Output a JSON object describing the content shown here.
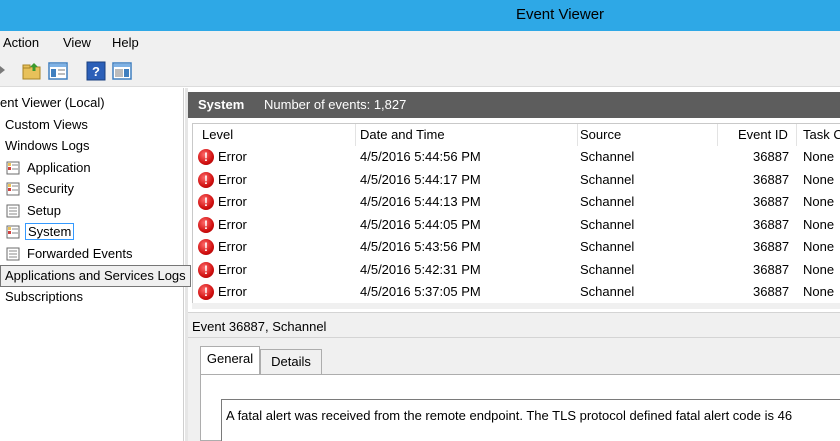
{
  "window": {
    "title": "Event Viewer"
  },
  "menu": [
    "Action",
    "View",
    "Help"
  ],
  "toolbar": {
    "icons": [
      "back-arrow-icon",
      "folder-up-icon",
      "show-hide-tree-icon",
      "help-icon",
      "action-pane-icon"
    ]
  },
  "tree": {
    "root": "ent Viewer (Local)",
    "custom_views": "Custom Views",
    "windows_logs": "Windows Logs",
    "application": "Application",
    "security": "Security",
    "setup": "Setup",
    "system": "System",
    "forwarded_events": "Forwarded Events",
    "subscriptions": "Subscriptions",
    "tooltip": "Applications and Services Logs"
  },
  "header": {
    "title": "System",
    "count": "Number of events: 1,827"
  },
  "columns": {
    "level": "Level",
    "date_time": "Date and Time",
    "source": "Source",
    "event_id": "Event ID",
    "task": "Task C"
  },
  "events": [
    {
      "level": "Error",
      "date_time": "4/5/2016 5:44:56 PM",
      "source": "Schannel",
      "event_id": "36887",
      "task": "None"
    },
    {
      "level": "Error",
      "date_time": "4/5/2016 5:44:17 PM",
      "source": "Schannel",
      "event_id": "36887",
      "task": "None"
    },
    {
      "level": "Error",
      "date_time": "4/5/2016 5:44:13 PM",
      "source": "Schannel",
      "event_id": "36887",
      "task": "None"
    },
    {
      "level": "Error",
      "date_time": "4/5/2016 5:44:05 PM",
      "source": "Schannel",
      "event_id": "36887",
      "task": "None"
    },
    {
      "level": "Error",
      "date_time": "4/5/2016 5:43:56 PM",
      "source": "Schannel",
      "event_id": "36887",
      "task": "None"
    },
    {
      "level": "Error",
      "date_time": "4/5/2016 5:42:31 PM",
      "source": "Schannel",
      "event_id": "36887",
      "task": "None"
    },
    {
      "level": "Error",
      "date_time": "4/5/2016 5:37:05 PM",
      "source": "Schannel",
      "event_id": "36887",
      "task": "None"
    }
  ],
  "detail": {
    "title": "Event 36887, Schannel",
    "tabs": [
      "General",
      "Details"
    ],
    "message": "A fatal alert was received from the remote endpoint. The TLS protocol defined fatal alert code is 46"
  },
  "colors": {
    "titlebar": "#2ea8e6",
    "header": "#5d5d5d",
    "selection": "#3399ff",
    "error": "#d01010"
  }
}
